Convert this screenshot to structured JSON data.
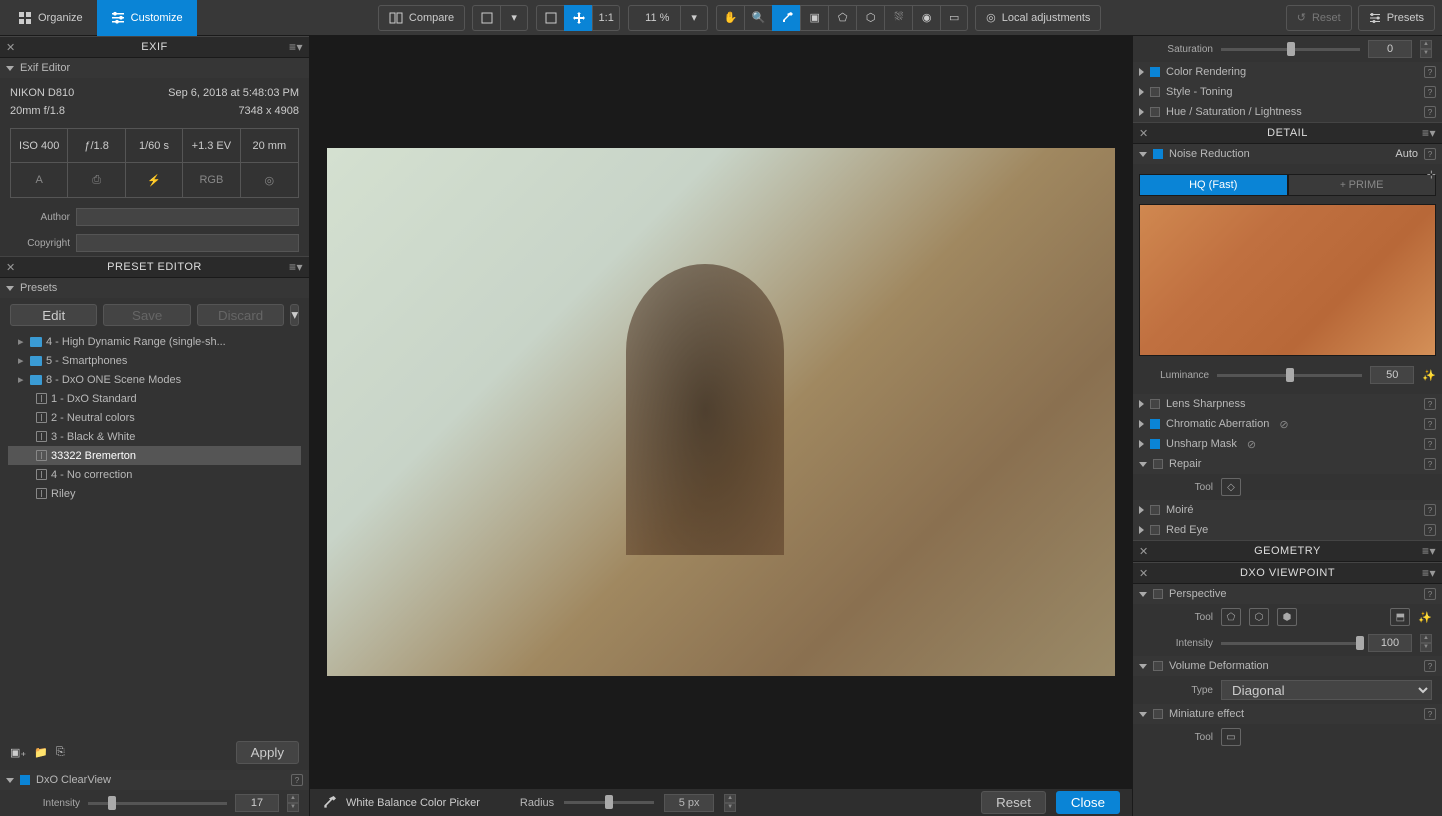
{
  "toolbar": {
    "organize": "Organize",
    "customize": "Customize",
    "compare": "Compare",
    "zoom_11": "1:1",
    "zoom_pct": "11 %",
    "local_adjustments": "Local adjustments",
    "reset": "Reset",
    "presets": "Presets"
  },
  "exif": {
    "panel_title": "EXIF",
    "section_title": "Exif Editor",
    "camera": "NIKON D810",
    "datetime": "Sep 6, 2018 at 5:48:03 PM",
    "lens": "20mm f/1.8",
    "dimensions": "7348 x 4908",
    "cells": [
      "ISO 400",
      "ƒ/1.8",
      "1/60 s",
      "+1.3 EV",
      "20 mm"
    ],
    "cells2": [
      "A",
      "⎙",
      "⚡",
      "RGB",
      "◎"
    ],
    "author_label": "Author",
    "copyright_label": "Copyright"
  },
  "preset_editor": {
    "panel_title": "PRESET EDITOR",
    "presets_label": "Presets",
    "edit": "Edit",
    "save": "Save",
    "discard": "Discard",
    "apply": "Apply",
    "items": [
      {
        "type": "folder",
        "label": "4 - High Dynamic Range (single-sh...",
        "lvl": 1
      },
      {
        "type": "folder",
        "label": "5 - Smartphones",
        "lvl": 1
      },
      {
        "type": "folder",
        "label": "8 - DxO ONE Scene Modes",
        "lvl": 1
      },
      {
        "type": "preset",
        "label": "1 - DxO Standard",
        "lvl": 2
      },
      {
        "type": "preset",
        "label": "2 - Neutral colors",
        "lvl": 2
      },
      {
        "type": "preset",
        "label": "3 - Black & White",
        "lvl": 2
      },
      {
        "type": "preset",
        "label": "33322 Bremerton",
        "lvl": 2,
        "selected": true
      },
      {
        "type": "preset",
        "label": "4 - No correction",
        "lvl": 2
      },
      {
        "type": "preset",
        "label": "Riley",
        "lvl": 2
      }
    ]
  },
  "clearview": {
    "title": "DxO ClearView",
    "intensity_label": "Intensity",
    "intensity_value": "17"
  },
  "right": {
    "saturation_label": "Saturation",
    "saturation_value": "0",
    "color_rendering": "Color Rendering",
    "style_toning": "Style - Toning",
    "hsl": "Hue / Saturation / Lightness",
    "detail_title": "DETAIL",
    "noise_reduction": "Noise Reduction",
    "auto": "Auto",
    "hq": "HQ (Fast)",
    "prime": "PRIME",
    "luminance_label": "Luminance",
    "luminance_value": "50",
    "lens_sharpness": "Lens Sharpness",
    "chromatic_aberration": "Chromatic Aberration",
    "unsharp_mask": "Unsharp Mask",
    "repair": "Repair",
    "tool_label": "Tool",
    "moire": "Moiré",
    "red_eye": "Red Eye",
    "geometry_title": "GEOMETRY",
    "viewpoint_title": "DXO VIEWPOINT",
    "perspective": "Perspective",
    "persp_intensity_label": "Intensity",
    "persp_intensity_value": "100",
    "volume_deformation": "Volume Deformation",
    "vd_type_label": "Type",
    "vd_type_value": "Diagonal",
    "miniature": "Miniature effect"
  },
  "bottom": {
    "wb_picker": "White Balance Color Picker",
    "radius_label": "Radius",
    "radius_value": "5 px",
    "reset": "Reset",
    "close": "Close"
  }
}
